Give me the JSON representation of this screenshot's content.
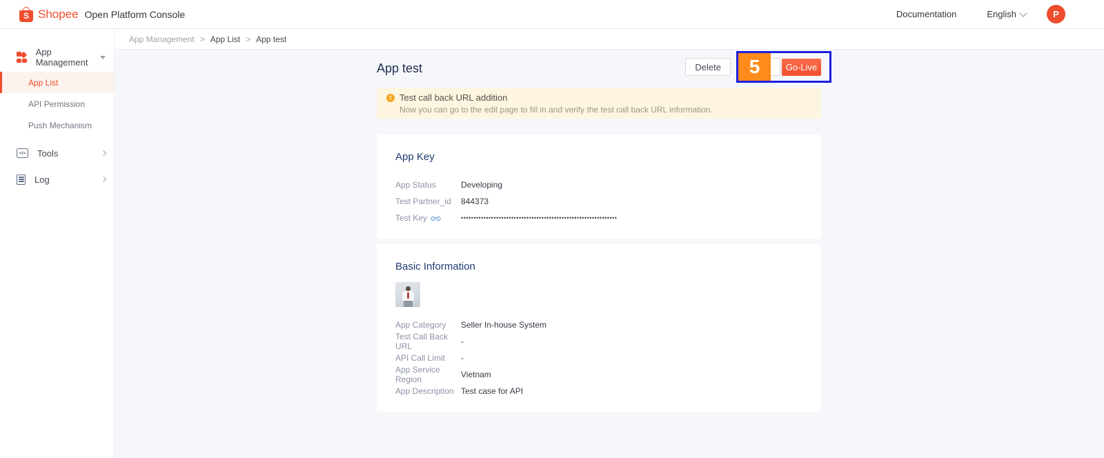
{
  "header": {
    "brand": "Shopee",
    "brand_initial": "S",
    "product": "Open Platform Console",
    "documentation": "Documentation",
    "language": "English",
    "avatar_initial": "P"
  },
  "sidebar": {
    "code_glyph": "</>",
    "items": [
      {
        "label": "App Management"
      },
      {
        "label": "App List"
      },
      {
        "label": "API Permission"
      },
      {
        "label": "Push Mechanism"
      },
      {
        "label": "Tools"
      },
      {
        "label": "Log"
      }
    ]
  },
  "breadcrumb": {
    "separator": ">",
    "items": [
      "App Management",
      "App List",
      "App test"
    ]
  },
  "page": {
    "title": "App test",
    "actions": {
      "delete": "Delete",
      "golive": "Go-Live"
    },
    "annotation": {
      "number": "5"
    }
  },
  "banner": {
    "icon_glyph": "!",
    "title": "Test call back URL addition",
    "message": "Now you can go to the edit page to fill in and verify the test call back URL information."
  },
  "app_key": {
    "title": "App Key",
    "rows": [
      {
        "label": "App Status",
        "value": "Developing"
      },
      {
        "label": "Test Partner_id",
        "value": "844373"
      },
      {
        "label": "Test Key",
        "value": "••••••••••••••••••••••••••••••••••••••••••••••••••••••••••••••"
      }
    ]
  },
  "basic_info": {
    "title": "Basic Information",
    "rows": [
      {
        "label": "App Category",
        "value": "Seller In-house System"
      },
      {
        "label": "Test Call Back URL",
        "value": "-"
      },
      {
        "label": "API Call Limit",
        "value": "-"
      },
      {
        "label": "App Service Region",
        "value": "Vietnam"
      },
      {
        "label": "App Description",
        "value": "Test case for API"
      }
    ]
  },
  "colors": {
    "shopee_orange": "#ee4d2d",
    "golive_orange": "#f3502f",
    "annotation_blue": "#1d1de0",
    "annotation_orange": "#ff8c1a",
    "banner_bg": "#fdf5e0",
    "card_title_navy": "#1c3c6e",
    "page_bg": "#f6f7fb"
  }
}
